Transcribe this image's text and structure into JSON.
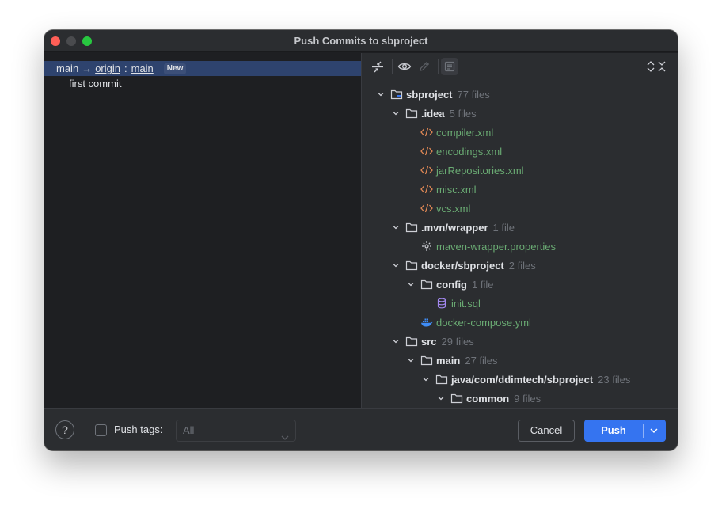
{
  "window": {
    "title": "Push Commits to sbproject"
  },
  "commits": {
    "branch_row": {
      "local": "main",
      "arrow": "→",
      "remote": "origin",
      "remote_branch": "main",
      "badge": "New"
    },
    "messages": [
      "first commit"
    ]
  },
  "tree": {
    "rows": [
      {
        "depth": 0,
        "type": "root",
        "name": "sbproject",
        "count": "77 files",
        "expanded": true
      },
      {
        "depth": 1,
        "type": "folder",
        "name": ".idea",
        "count": "5 files",
        "expanded": true
      },
      {
        "depth": 2,
        "type": "xml",
        "name": "compiler.xml",
        "count": ""
      },
      {
        "depth": 2,
        "type": "xml",
        "name": "encodings.xml",
        "count": ""
      },
      {
        "depth": 2,
        "type": "xml",
        "name": "jarRepositories.xml",
        "count": ""
      },
      {
        "depth": 2,
        "type": "xml",
        "name": "misc.xml",
        "count": ""
      },
      {
        "depth": 2,
        "type": "xml",
        "name": "vcs.xml",
        "count": ""
      },
      {
        "depth": 1,
        "type": "folder",
        "name": ".mvn/wrapper",
        "count": "1 file",
        "expanded": true
      },
      {
        "depth": 2,
        "type": "properties",
        "name": "maven-wrapper.properties",
        "count": ""
      },
      {
        "depth": 1,
        "type": "folder",
        "name": "docker/sbproject",
        "count": "2 files",
        "expanded": true
      },
      {
        "depth": 2,
        "type": "folder",
        "name": "config",
        "count": "1 file",
        "expanded": true
      },
      {
        "depth": 3,
        "type": "sql",
        "name": "init.sql",
        "count": ""
      },
      {
        "depth": 2,
        "type": "docker",
        "name": "docker-compose.yml",
        "count": ""
      },
      {
        "depth": 1,
        "type": "folder",
        "name": "src",
        "count": "29 files",
        "expanded": true
      },
      {
        "depth": 2,
        "type": "folder",
        "name": "main",
        "count": "27 files",
        "expanded": true
      },
      {
        "depth": 3,
        "type": "folder",
        "name": "java/com/ddimtech/sbproject",
        "count": "23 files",
        "expanded": true
      },
      {
        "depth": 4,
        "type": "folder",
        "name": "common",
        "count": "9 files",
        "expanded": true
      }
    ]
  },
  "footer": {
    "help_label": "?",
    "push_tags_label": "Push tags:",
    "tags_value": "All",
    "cancel_label": "Cancel",
    "push_label": "Push"
  },
  "colors": {
    "accent": "#3574f0",
    "selection": "#2e436e",
    "added_file": "#6aab73",
    "xml_icon": "#e08855"
  }
}
